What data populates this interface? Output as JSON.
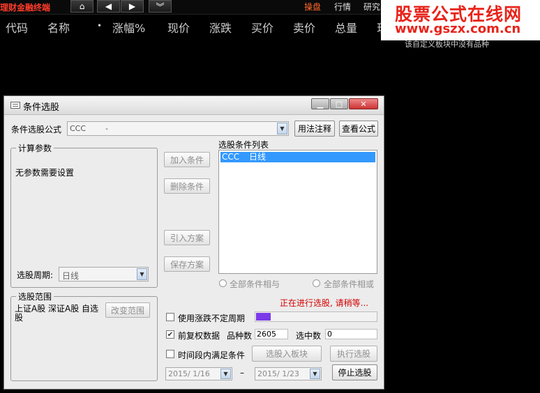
{
  "topbar": {
    "app_title": "理财金融终端",
    "links": [
      "操盘",
      "行情",
      "研究"
    ],
    "link_colors": {
      "active": "#ff6a2a",
      "normal": "#dddddd"
    }
  },
  "watermark": {
    "name": "股票公式在线网",
    "url": "www.gszx.com.cn"
  },
  "columns": [
    "代码",
    "名称",
    "•",
    "涨幅%",
    "现价",
    "涨跌",
    "买价",
    "卖价",
    "总量",
    "现"
  ],
  "hint": "该自定义板块中没有品种",
  "dialog": {
    "title": "条件选股",
    "formula_label": "条件选股公式",
    "formula_value": "CCC        -",
    "usage_button": "用法注释",
    "view_button": "查看公式",
    "params_group": "计算参数",
    "params_text": "无参数需要设置",
    "period_label": "选股周期:",
    "period_value": "日线",
    "add_button": "加入条件",
    "delete_button": "删除条件",
    "import_button": "引入方案",
    "save_button": "保存方案",
    "conditions_label": "选股条件列表",
    "conditions": [
      {
        "name": "CCC",
        "period": "日线"
      }
    ],
    "all_and": "全部条件相与",
    "all_or": "全部条件相或",
    "range_group": "选股范围",
    "range_text": "上证A股 深证A股 自选股",
    "change_range_button": "改变范围",
    "status": "正在进行选股, 请稍等...",
    "progress": 0.12,
    "use_limit": "使用涨跌不定周期",
    "use_limit_checked": false,
    "fq_label": "前复权数据",
    "fq_checked": true,
    "count_label": "品种数",
    "count_value": "2605",
    "selected_label": "选中数",
    "selected_value": "0",
    "period_cond": "时间段内满足条件",
    "period_cond_checked": false,
    "to_block_button": "选股入板块",
    "run_button": "执行选股",
    "date_start": "2015/ 1/16",
    "date_sep": "–",
    "date_end": "2015/ 1/23",
    "stop_button": "停止选股",
    "colors": {
      "accent": "#3399ff",
      "progress": "#7b39e8",
      "status": "#d40000"
    }
  }
}
